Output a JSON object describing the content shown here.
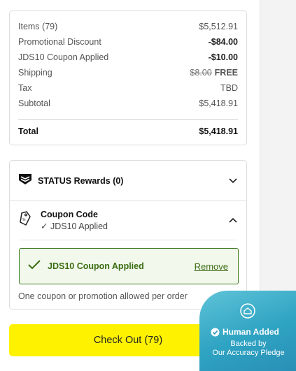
{
  "summary": {
    "items_label": "Items (79)",
    "items_value": "$5,512.91",
    "promo_label": "Promotional Discount",
    "promo_value": "-$84.00",
    "coupon_label": "JDS10 Coupon Applied",
    "coupon_value": "-$10.00",
    "shipping_label": "Shipping",
    "shipping_old": "$8.00",
    "shipping_value": "FREE",
    "tax_label": "Tax",
    "tax_value": "TBD",
    "subtotal_label": "Subtotal",
    "subtotal_value": "$5,418.91",
    "total_label": "Total",
    "total_value": "$5,418.91"
  },
  "rewards": {
    "title": "STATUS Rewards (0)"
  },
  "coupon": {
    "title": "Coupon Code",
    "applied_sub": "JDS10 Applied",
    "applied_box_text": "JDS10 Coupon Applied",
    "remove_label": "Remove",
    "note": "One coupon or promotion allowed per order"
  },
  "checkout": {
    "label": "Check Out (79)"
  },
  "badge": {
    "line1": "Human Added",
    "line2": "Backed by",
    "line3": "Our Accuracy Pledge"
  },
  "colors": {
    "accent_yellow": "#fff200",
    "success_green": "#3b6d13",
    "badge_teal": "#2ea3c2"
  }
}
